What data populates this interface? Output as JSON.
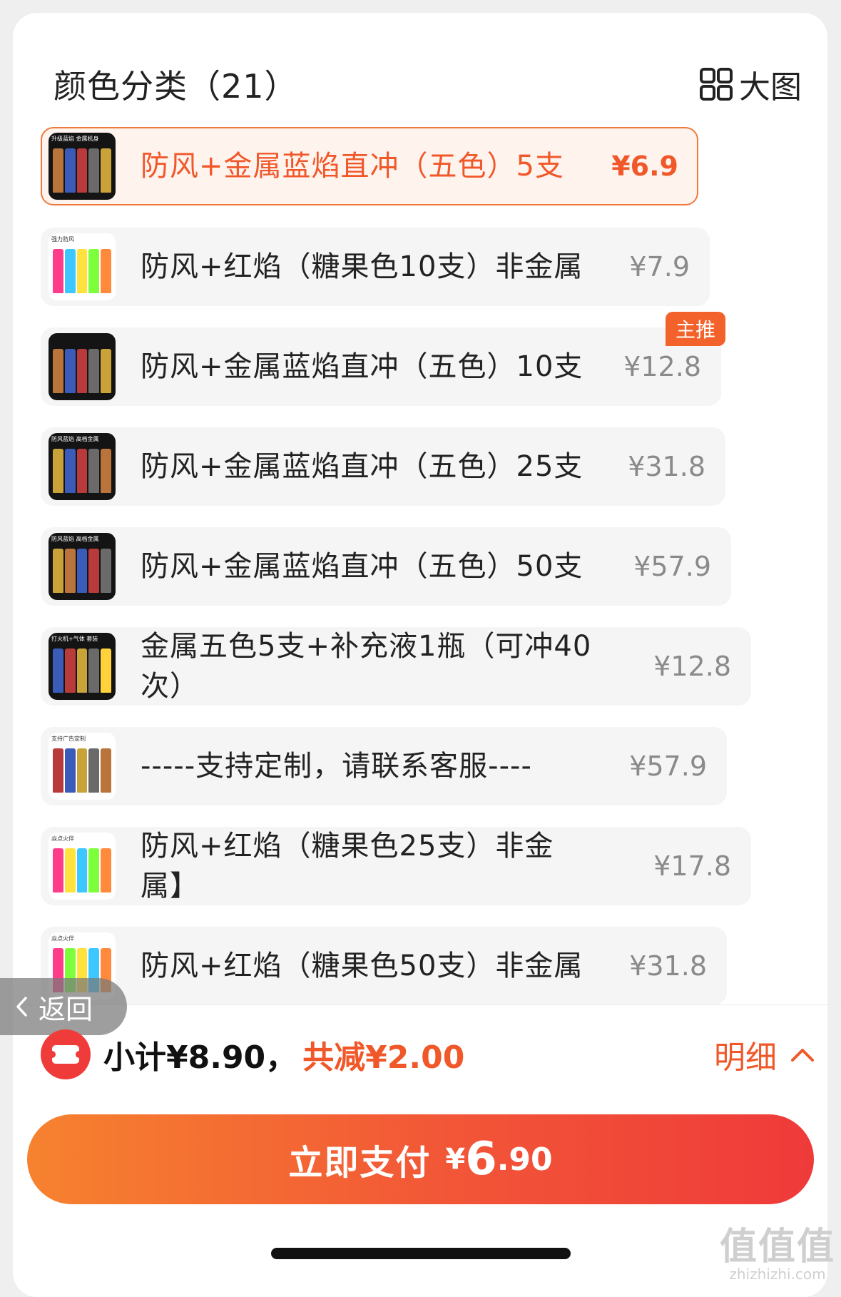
{
  "header": {
    "title": "颜色分类（21）",
    "big_view_label": "大图"
  },
  "skus": [
    {
      "name": "防风+金属蓝焰直冲（五色）5支",
      "price": "¥6.9",
      "thumb_tag": "升级蓝焰 金属机身"
    },
    {
      "name": "防风+红焰（糖果色10支）非金属",
      "price": "¥7.9",
      "thumb_tag": "强力防风"
    },
    {
      "name": "防风+金属蓝焰直冲（五色）10支",
      "price": "¥12.8",
      "badge": "主推"
    },
    {
      "name": "防风+金属蓝焰直冲（五色）25支",
      "price": "¥31.8",
      "thumb_tag": "防风蓝焰 高档金属"
    },
    {
      "name": "防风+金属蓝焰直冲（五色）50支",
      "price": "¥57.9",
      "thumb_tag": "防风蓝焰 高档金属"
    },
    {
      "name": "金属五色5支+补充液1瓶（可冲40次）",
      "price": "¥12.8",
      "thumb_tag": "打火机+气体 套装"
    },
    {
      "name": "-----支持定制，请联系客服----",
      "price": "¥57.9",
      "thumb_tag": "支持广告定制"
    },
    {
      "name": "防风+红焰（糖果色25支）非金属】",
      "price": "¥17.8",
      "thumb_tag": "焱点火伴"
    },
    {
      "name": "防风+红焰（糖果色50支）非金属",
      "price": "¥31.8",
      "thumb_tag": "焱点火伴"
    }
  ],
  "back_label": "返回",
  "summary": {
    "subtotal": "小计¥8.90，",
    "discount": "共减¥2.00",
    "detail_label": "明细"
  },
  "pay_button": {
    "label": "立即支付",
    "currency": "¥",
    "amount_int": "6",
    "amount_dec": ".90"
  },
  "watermark": {
    "main": "值值值",
    "sub": "zhizhizhi.com"
  },
  "colors": {
    "accent": "#f0582a",
    "badge": "#f3622b",
    "coupon_red": "#f03b3b",
    "pay_gradient_start": "#f6822f",
    "pay_gradient_end": "#ef3a3a"
  }
}
